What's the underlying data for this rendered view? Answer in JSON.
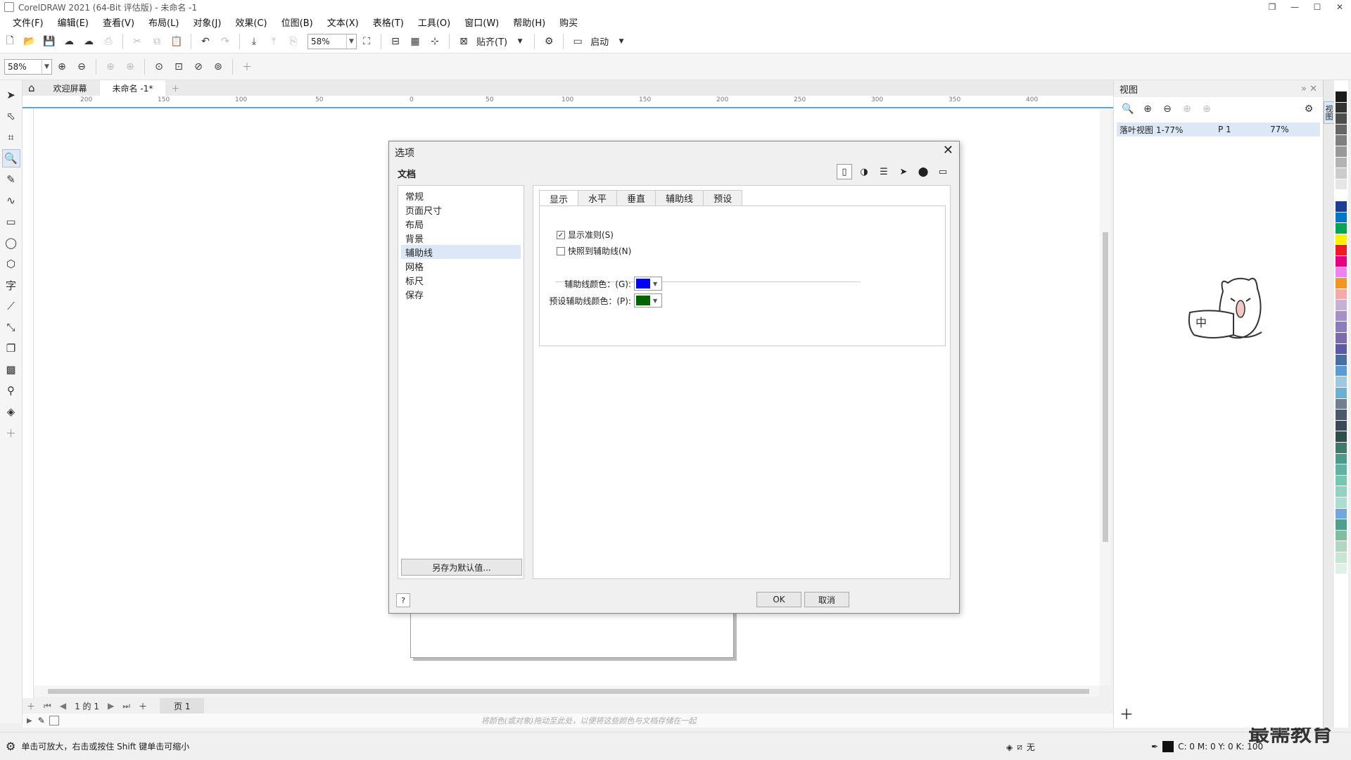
{
  "window": {
    "title": "CorelDRAW 2021 (64-Bit 评估版) - 未命名 -1"
  },
  "menu": [
    "文件(F)",
    "编辑(E)",
    "查看(V)",
    "布局(L)",
    "对象(J)",
    "效果(C)",
    "位图(B)",
    "文本(X)",
    "表格(T)",
    "工具(O)",
    "窗口(W)",
    "帮助(H)",
    "购买"
  ],
  "toolbar": {
    "zoom": "58%",
    "snap_label": "贴齐(T)",
    "launch_label": "启动"
  },
  "property_bar": {
    "zoom": "58%"
  },
  "doc_tabs": {
    "welcome": "欢迎屏幕",
    "current": "未命名 -1*"
  },
  "ruler_ticks": [
    "200",
    "150",
    "100",
    "50",
    "0",
    "50",
    "100",
    "150",
    "200",
    "250",
    "300",
    "350",
    "400"
  ],
  "page_nav": {
    "counter": "1 的 1",
    "page_tab": "页 1"
  },
  "color_hint": "将颜色(或对象)拖动至此处，以便将这些颜色与文档存储在一起",
  "status": {
    "hint": "单击可放大，右击或按住 Shift 键单击可缩小",
    "fill": "无",
    "outline": "C: 0 M: 0 Y: 0 K: 100"
  },
  "watermark": "最需教育",
  "docker": {
    "title": "视图",
    "row": {
      "name": "落叶视图 1-77%",
      "page": "P 1",
      "zoom": "77%"
    },
    "mascot_text": "中",
    "side_tab": "视图"
  },
  "dialog": {
    "title": "选项",
    "section": "文档",
    "tree": [
      "常规",
      "页面尺寸",
      "布局",
      "背景",
      "辅助线",
      "网格",
      "标尺",
      "保存"
    ],
    "selected_tree": "辅助线",
    "save_default": "另存为默认值...",
    "tabs": [
      "显示",
      "水平",
      "垂直",
      "辅助线",
      "预设"
    ],
    "show_guides": "显示准则(S)",
    "snap_guides": "快照到辅助线(N)",
    "guide_color_label": "辅助线颜色：(G):",
    "preset_color_label": "预设辅助线颜色：(P):",
    "guide_color": "#0000ff",
    "preset_color": "#006400",
    "help": "?",
    "ok": "OK",
    "cancel": "取消"
  },
  "palette": [
    "#1a1a1a",
    "#333333",
    "#4d4d4d",
    "#666666",
    "#808080",
    "#999999",
    "#b3b3b3",
    "#cccccc",
    "#e6e6e6",
    "#ffffff",
    "#1c3f94",
    "#0077c8",
    "#00a651",
    "#fff200",
    "#ed1c24",
    "#e4007f",
    "#ee82ee",
    "#f7941d",
    "#f5a9a9",
    "#c2b3d6",
    "#a391c8",
    "#8b7bc0",
    "#7d6bb0",
    "#5c5aa8",
    "#4a6fa5",
    "#5b9bd5",
    "#9ecae1",
    "#6baed6",
    "#708090",
    "#4a5a6a",
    "#3a4a5a",
    "#2f4f4f",
    "#3d7a6a",
    "#4c9a8a",
    "#5fb3a0",
    "#76c7b0",
    "#8fd3c0",
    "#a8dfd0",
    "#6fa8dc",
    "#4f9f8f",
    "#7fbf9f",
    "#b0d8c0",
    "#c8e6d2",
    "#dff0e6"
  ]
}
